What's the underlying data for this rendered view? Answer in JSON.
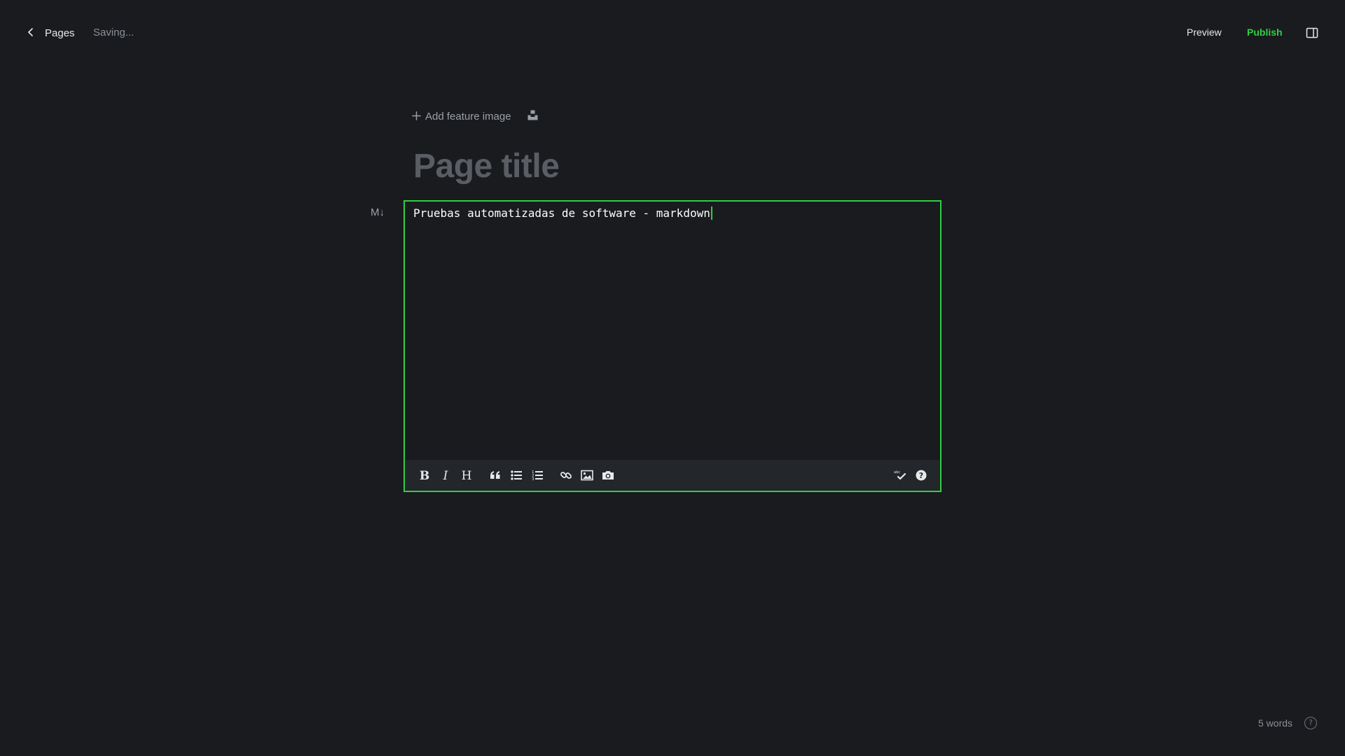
{
  "header": {
    "back_label": "Pages",
    "status": "Saving...",
    "preview_label": "Preview",
    "publish_label": "Publish"
  },
  "editor": {
    "add_feature_label": "Add feature image",
    "title_placeholder": "Page title",
    "markdown_indicator": "M↓",
    "content": "Pruebas automatizadas de software - markdown"
  },
  "toolbar": {
    "left_tools": [
      "bold-icon",
      "italic-icon",
      "heading-icon",
      "quote-icon",
      "unordered-list-icon",
      "ordered-list-icon",
      "link-icon",
      "image-icon",
      "camera-icon"
    ],
    "right_tools": [
      "spellcheck-icon",
      "help-icon"
    ]
  },
  "footer": {
    "word_count": "5 words",
    "help_glyph": "?"
  },
  "colors": {
    "background": "#191b1f",
    "accent": "#30cf43",
    "toolbar_bg": "#23262b",
    "muted_text": "#8a8f96",
    "title_placeholder": "#5a5e64"
  }
}
